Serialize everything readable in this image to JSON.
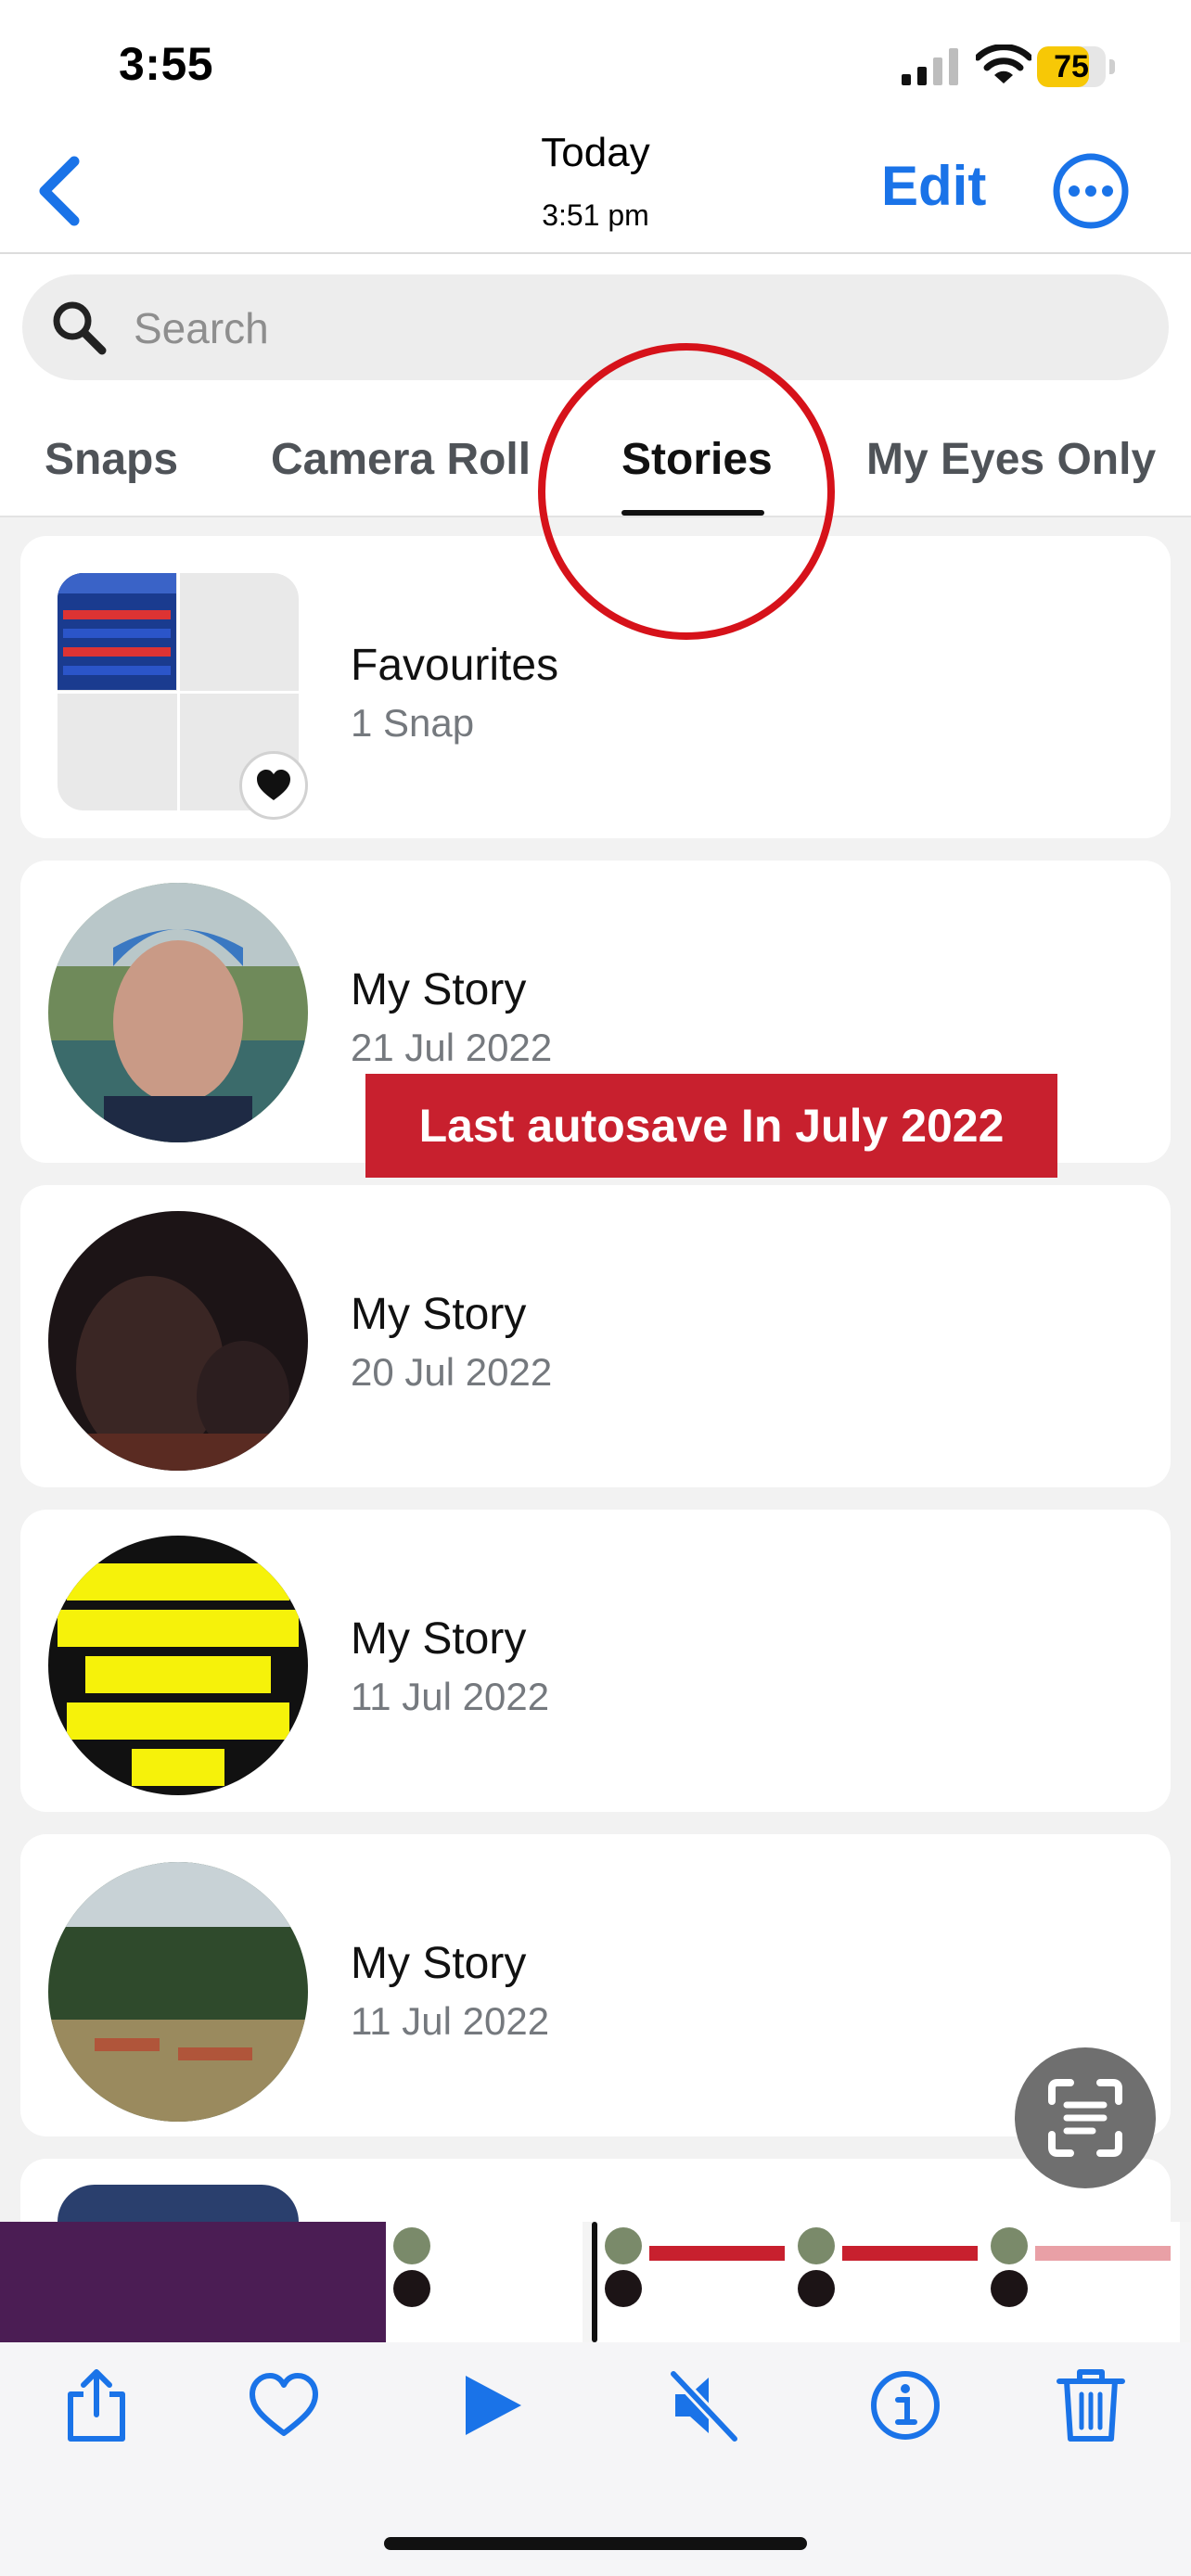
{
  "status_bar": {
    "time": "3:55",
    "battery": "75",
    "battery_level": 0.75
  },
  "nav": {
    "title": "Today",
    "subtitle": "3:51 pm",
    "edit_label": "Edit",
    "back_icon": "chevron-left-icon",
    "more_icon": "ellipsis-circle-icon"
  },
  "search": {
    "placeholder": "Search"
  },
  "tabs": [
    {
      "label": "Snaps",
      "active": false
    },
    {
      "label": "Camera Roll",
      "active": false
    },
    {
      "label": "Stories",
      "active": true
    },
    {
      "label": "My Eyes Only",
      "active": false
    }
  ],
  "list": [
    {
      "title": "Favourites",
      "subtitle": "1 Snap"
    },
    {
      "title": "My Story",
      "subtitle": "21 Jul 2022"
    },
    {
      "title": "My Story",
      "subtitle": "20 Jul 2022"
    },
    {
      "title": "My Story",
      "subtitle": "11 Jul 2022"
    },
    {
      "title": "My Story",
      "subtitle": "11 Jul 2022"
    }
  ],
  "overlay": {
    "autosave_text": "Last autosave In July 2022"
  },
  "colors": {
    "accent": "#1a73e8",
    "annotation_red": "#d6121a",
    "banner_red": "#c8202e"
  },
  "toolbar": {
    "icons": [
      "share-icon",
      "heart-icon",
      "play-icon",
      "mute-icon",
      "info-icon",
      "trash-icon"
    ]
  }
}
